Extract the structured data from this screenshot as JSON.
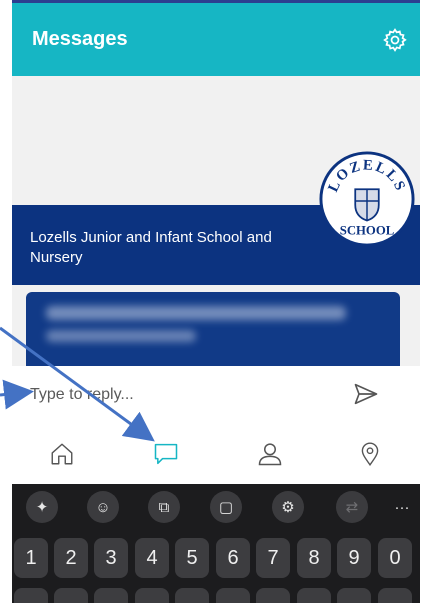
{
  "header": {
    "title": "Messages",
    "settings_icon": "gear-icon"
  },
  "school": {
    "name": "Lozells Junior and Infant School and Nursery",
    "logo_top": "LOZELLS",
    "logo_bottom": "SCHOOL"
  },
  "reply": {
    "placeholder": "Type to reply...",
    "send_icon": "send-icon"
  },
  "nav": {
    "items": [
      "home-icon",
      "chat-icon",
      "profile-icon",
      "location-icon"
    ],
    "active": "chat-icon"
  },
  "keyboard": {
    "toolbar": [
      "sparkle-icon",
      "emoji-icon",
      "translate-icon",
      "clipboard-icon",
      "settings-icon",
      "convert-icon",
      "more-icon"
    ],
    "more_label": "···",
    "number_keys": [
      "1",
      "2",
      "3",
      "4",
      "5",
      "6",
      "7",
      "8",
      "9",
      "0"
    ]
  },
  "colors": {
    "header": "#16b6c4",
    "banner": "#0c3380",
    "active_nav": "#16b6c4",
    "annotation_arrow": "#4472c4"
  }
}
